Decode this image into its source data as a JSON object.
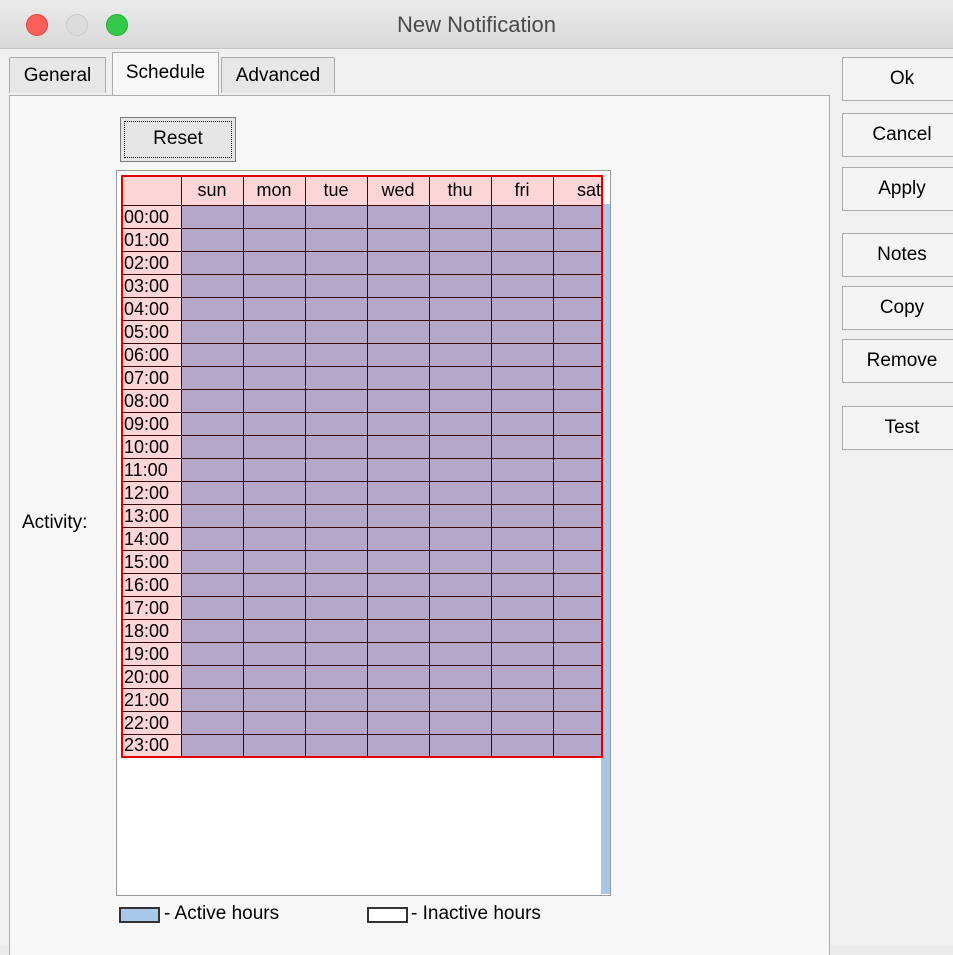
{
  "window": {
    "title": "New Notification",
    "controls": {
      "close_color": "#fc5f57",
      "minimize_color": "#dcdcdc",
      "zoom_color": "#34c84a"
    }
  },
  "tabs": [
    {
      "label": "General",
      "active": false
    },
    {
      "label": "Schedule",
      "active": true
    },
    {
      "label": "Advanced",
      "active": false
    }
  ],
  "buttons": {
    "ok": "Ok",
    "cancel": "Cancel",
    "apply": "Apply",
    "notes": "Notes",
    "copy": "Copy",
    "remove": "Remove",
    "test": "Test"
  },
  "schedule": {
    "reset_label": "Reset",
    "activity_label": "Activity:",
    "days": [
      "sun",
      "mon",
      "tue",
      "wed",
      "thu",
      "fri",
      "sat"
    ],
    "hours": [
      "00:00",
      "01:00",
      "02:00",
      "03:00",
      "04:00",
      "05:00",
      "06:00",
      "07:00",
      "08:00",
      "09:00",
      "10:00",
      "11:00",
      "12:00",
      "13:00",
      "14:00",
      "15:00",
      "16:00",
      "17:00",
      "18:00",
      "19:00",
      "20:00",
      "21:00",
      "22:00",
      "23:00"
    ],
    "all_slots_selected": true,
    "colors": {
      "header_bg": "#fcd6d6",
      "selected_slot": "#b4a7c8",
      "selection_border": "#e00000",
      "active_hours": "#a8c8ea",
      "inactive_hours": "#ffffff"
    }
  },
  "legend": {
    "active_label": "- Active hours",
    "inactive_label": "- Inactive hours"
  }
}
